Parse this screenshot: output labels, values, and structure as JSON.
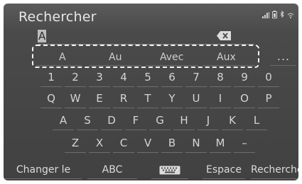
{
  "header": {
    "title": "Rechercher"
  },
  "input": {
    "value": "A"
  },
  "suggestions": [
    "A",
    "Au",
    "Avec",
    "Aux"
  ],
  "more_label": "...",
  "keyboard": {
    "row1": [
      "1",
      "2",
      "3",
      "4",
      "5",
      "6",
      "7",
      "8",
      "9",
      "0"
    ],
    "row2": [
      "Q",
      "W",
      "E",
      "R",
      "T",
      "Y",
      "U",
      "I",
      "O",
      "P"
    ],
    "row3": [
      "A",
      "S",
      "D",
      "F",
      "G",
      "H",
      "J",
      "K",
      "L"
    ],
    "row4": [
      "Z",
      "X",
      "C",
      "V",
      "B",
      "N",
      "M",
      "–"
    ]
  },
  "bottom": {
    "change_type": "Changer le type",
    "abc": "ABC",
    "space": "Espace",
    "search": "Rechercher"
  },
  "colors": {
    "background": "#4a4a4a",
    "text": "#dcdcdc",
    "highlight_border": "#f2f2f2"
  }
}
